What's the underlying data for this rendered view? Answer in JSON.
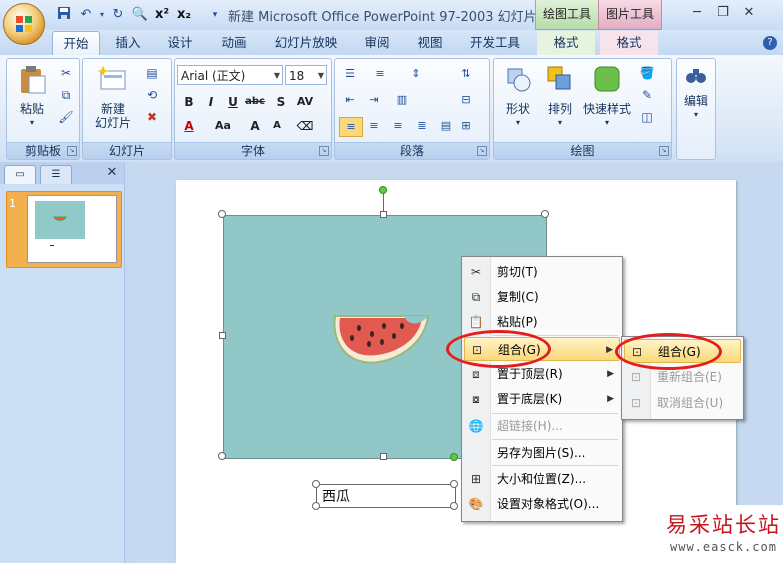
{
  "window": {
    "title": "新建 Microsoft Office PowerPoint 97-2003 幻灯片...",
    "context_tab_groups": [
      "绘图工具",
      "图片工具"
    ]
  },
  "tabs": [
    "开始",
    "插入",
    "设计",
    "动画",
    "幻灯片放映",
    "审阅",
    "视图",
    "开发工具",
    "格式",
    "格式"
  ],
  "ribbon": {
    "clipboard": {
      "paste": "粘贴",
      "label": "剪贴板"
    },
    "slides": {
      "new_slide_1": "新建",
      "new_slide_2": "幻灯片",
      "label": "幻灯片"
    },
    "font": {
      "font_name": "Arial (正文)",
      "font_size": "18",
      "label": "字体"
    },
    "paragraph": {
      "label": "段落"
    },
    "drawing": {
      "shape": "形状",
      "arrange": "排列",
      "quick_styles": "快速样式",
      "label": "绘图"
    },
    "editing": {
      "edit": "编辑"
    }
  },
  "slide_pane": {
    "slide_number": "1"
  },
  "slide": {
    "textbox_text": "西瓜"
  },
  "context_menu": {
    "items": [
      {
        "label": "剪切(T)",
        "icon": "scissors-icon"
      },
      {
        "label": "复制(C)",
        "icon": "copy-icon"
      },
      {
        "label": "粘贴(P)",
        "icon": "paste-icon"
      },
      {
        "label": "组合(G)",
        "icon": "group-icon"
      },
      {
        "label": "置于顶层(R)",
        "icon": "bring-front-icon"
      },
      {
        "label": "置于底层(K)",
        "icon": "send-back-icon"
      },
      {
        "label": "超链接(H)...",
        "icon": "hyperlink-icon"
      },
      {
        "label": "另存为图片(S)...",
        "icon": ""
      },
      {
        "label": "大小和位置(Z)...",
        "icon": "size-icon"
      },
      {
        "label": "设置对象格式(O)...",
        "icon": "format-icon"
      }
    ]
  },
  "submenu": {
    "items": [
      {
        "label": "组合(G)"
      },
      {
        "label": "重新组合(E)"
      },
      {
        "label": "取消组合(U)"
      }
    ]
  },
  "watermark": {
    "text": "易采站长站",
    "url": "www.easck.com"
  },
  "colors": {
    "accent_red": "#e41c1c",
    "picture_bg": "#92c7c7",
    "highlight": "#fbd97a"
  }
}
